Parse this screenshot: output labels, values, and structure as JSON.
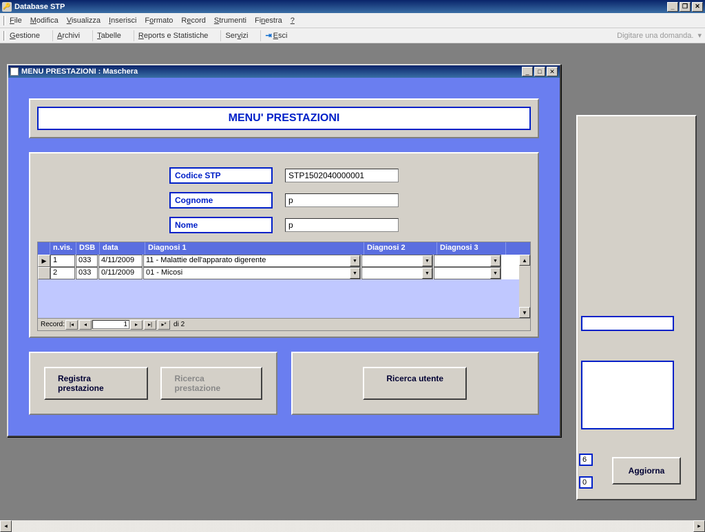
{
  "app": {
    "title": "Database STP"
  },
  "menu": {
    "file": "File",
    "modifica": "Modifica",
    "visualizza": "Visualizza",
    "inserisci": "Inserisci",
    "formato": "Formato",
    "record": "Record",
    "strumenti": "Strumenti",
    "finestra": "Finestra",
    "help": "?"
  },
  "toolbar": {
    "gestione": "Gestione",
    "archivi": "Archivi",
    "tabelle": "Tabelle",
    "reports": "Reports e Statistiche",
    "servizi": "Servizi",
    "esci": "Esci",
    "hint": "Digitare una domanda."
  },
  "child": {
    "title": "MENU PRESTAZIONI : Maschera",
    "heading": "MENU' PRESTAZIONI",
    "labels": {
      "codice": "Codice STP",
      "cognome": "Cognome",
      "nome": "Nome"
    },
    "values": {
      "codice": "STP1502040000001",
      "cognome": "p",
      "nome": "p"
    },
    "grid": {
      "headers": {
        "nvis": "n.vis.",
        "dsb": "DSB",
        "data": "data",
        "d1": "Diagnosi 1",
        "d2": "Diagnosi 2",
        "d3": "Diagnosi 3"
      },
      "rows": [
        {
          "nvis": "1",
          "dsb": "033",
          "data": "4/11/2009",
          "d1": "11 - Malattie dell'apparato digerente",
          "d2": "",
          "d3": ""
        },
        {
          "nvis": "2",
          "dsb": "033",
          "data": "0/11/2009",
          "d1": "01 - Micosi",
          "d2": "",
          "d3": ""
        }
      ],
      "nav": {
        "label": "Record:",
        "current": "1",
        "total": "di 2"
      }
    },
    "buttons": {
      "registra": "Registra prestazione",
      "ricerca_p": "Ricerca prestazione",
      "ricerca_u": "Ricerca utente"
    }
  },
  "bg": {
    "val1": "6",
    "val2": "0",
    "aggiorna": "Aggiorna"
  }
}
